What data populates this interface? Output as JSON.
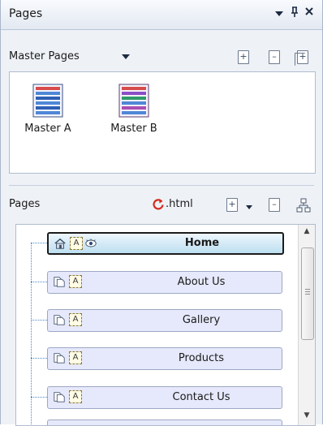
{
  "panel": {
    "title": "Pages",
    "controls": {
      "dropdown": "▾",
      "pin": "ᵖ",
      "close": "✕"
    }
  },
  "master": {
    "label": "Master Pages",
    "items": [
      {
        "label": "Master A"
      },
      {
        "label": "Master B"
      }
    ]
  },
  "pages": {
    "label": "Pages",
    "html_label": ".html",
    "items": [
      {
        "label": "Home",
        "selected": true
      },
      {
        "label": "About Us"
      },
      {
        "label": "Gallery"
      },
      {
        "label": "Products"
      },
      {
        "label": "Contact Us"
      }
    ]
  },
  "colors": {
    "accent_refresh": "#d42a1e",
    "tree_line": "#4a88c8",
    "node_bg": "#e6e9fb"
  }
}
